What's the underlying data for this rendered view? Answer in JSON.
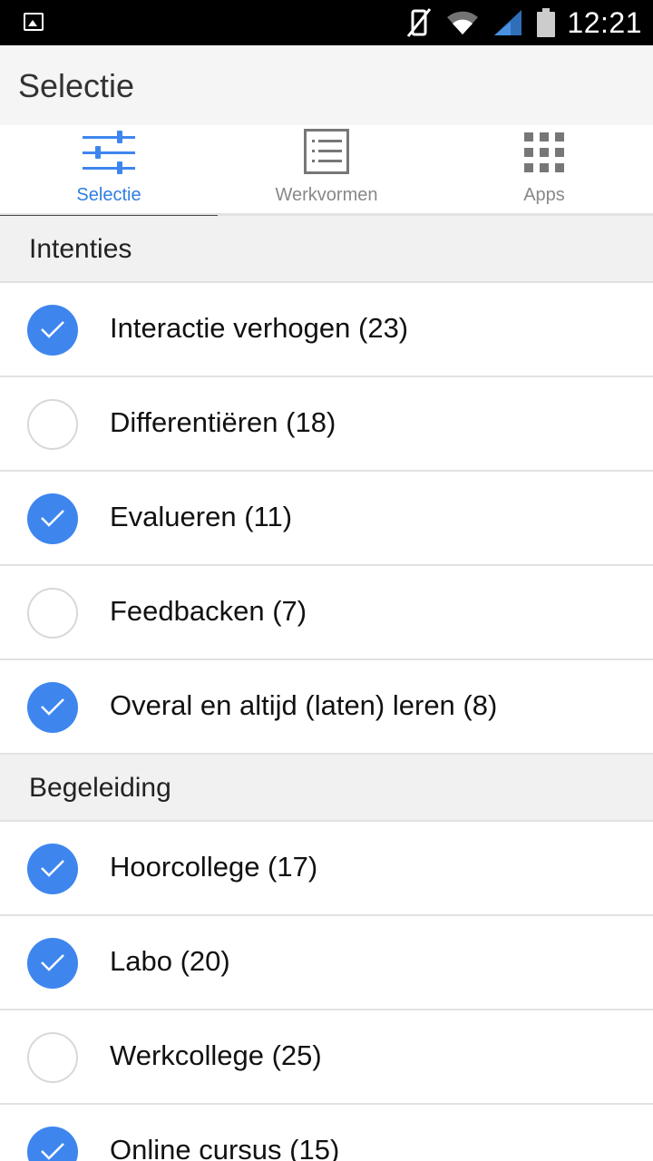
{
  "status_bar": {
    "time": "12:21",
    "icons": [
      "image-icon",
      "vibrate-off-icon",
      "wifi-icon",
      "signal-icon",
      "battery-icon"
    ]
  },
  "app_bar": {
    "title": "Selectie"
  },
  "tabs": [
    {
      "label": "Selectie",
      "icon": "sliders-icon",
      "active": true
    },
    {
      "label": "Werkvormen",
      "icon": "list-icon",
      "active": false
    },
    {
      "label": "Apps",
      "icon": "apps-grid-icon",
      "active": false
    }
  ],
  "colors": {
    "accent": "#3e86ee",
    "active_tab_text": "#2f7fe0",
    "section_bg": "#f1f1f1"
  },
  "sections": [
    {
      "title": "Intenties",
      "items": [
        {
          "label": "Interactie verhogen (23)",
          "checked": true
        },
        {
          "label": "Differentiëren (18)",
          "checked": false
        },
        {
          "label": "Evalueren (11)",
          "checked": true
        },
        {
          "label": "Feedbacken (7)",
          "checked": false
        },
        {
          "label": "Overal en altijd (laten) leren (8)",
          "checked": true
        }
      ]
    },
    {
      "title": "Begeleiding",
      "items": [
        {
          "label": "Hoorcollege (17)",
          "checked": true
        },
        {
          "label": "Labo (20)",
          "checked": true
        },
        {
          "label": "Werkcollege (25)",
          "checked": false
        },
        {
          "label": "Online cursus (15)",
          "checked": true
        }
      ]
    }
  ]
}
